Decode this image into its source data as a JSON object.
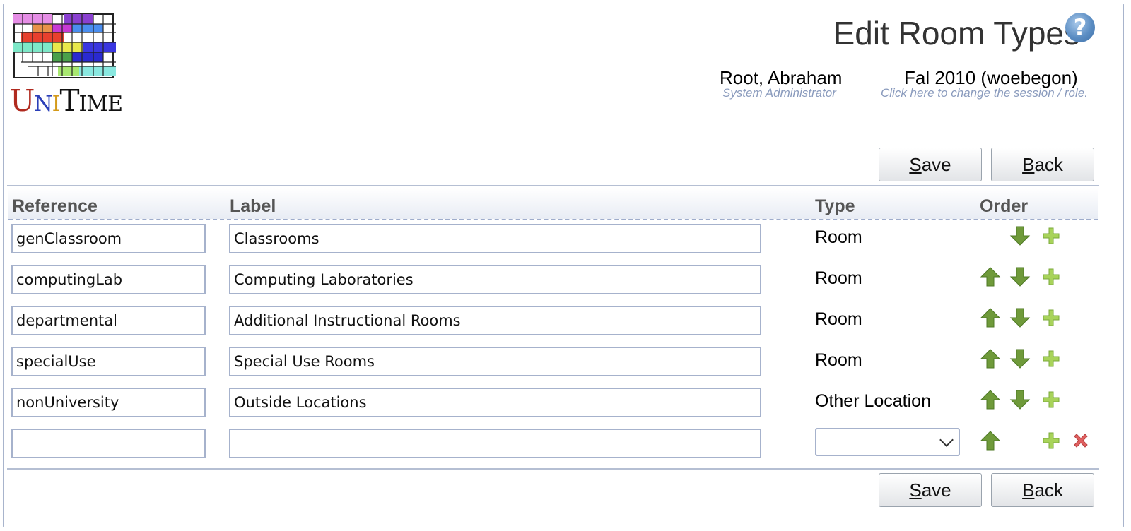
{
  "app": {
    "logo_word": "UniTime",
    "logo_letters": [
      "U",
      "N",
      "I",
      "T",
      "IME"
    ]
  },
  "header": {
    "title": "Edit Room Types",
    "help_icon": "question-circle-icon",
    "user": {
      "name": "Root, Abraham",
      "role": "System Administrator"
    },
    "session": {
      "name": "Fal 2010 (woebegon)",
      "hint": "Click here to change the session / role."
    }
  },
  "buttons": {
    "save_label": "Save",
    "save_mnemonic": "S",
    "save_rest": "ave",
    "back_label": "Back",
    "back_mnemonic": "B",
    "back_rest": "ack"
  },
  "table": {
    "columns": [
      "Reference",
      "Label",
      "Type",
      "Order"
    ],
    "rows": [
      {
        "reference": "genClassroom",
        "label": "Classrooms",
        "type": "Room",
        "can_up": false,
        "can_down": true,
        "can_add": true,
        "can_delete": false
      },
      {
        "reference": "computingLab",
        "label": "Computing Laboratories",
        "type": "Room",
        "can_up": true,
        "can_down": true,
        "can_add": true,
        "can_delete": false
      },
      {
        "reference": "departmental",
        "label": "Additional Instructional Rooms",
        "type": "Room",
        "can_up": true,
        "can_down": true,
        "can_add": true,
        "can_delete": false
      },
      {
        "reference": "specialUse",
        "label": "Special Use Rooms",
        "type": "Room",
        "can_up": true,
        "can_down": true,
        "can_add": true,
        "can_delete": false
      },
      {
        "reference": "nonUniversity",
        "label": "Outside Locations",
        "type": "Other Location",
        "can_up": true,
        "can_down": true,
        "can_add": true,
        "can_delete": false
      },
      {
        "reference": "",
        "label": "",
        "type": "",
        "can_up": true,
        "can_down": false,
        "can_add": true,
        "can_delete": true
      }
    ]
  },
  "icons": {
    "up": "arrow-up-icon",
    "down": "arrow-down-icon",
    "add": "plus-icon",
    "delete": "delete-x-icon"
  },
  "colors": {
    "title": "#333333",
    "hint": "#8a9bbd",
    "border": "#a6b2cc",
    "arrow_green": "#6f9a3a",
    "plus_green": "#a8d35a",
    "delete_red": "#e06060",
    "help_blue": "#5b8dc3"
  }
}
